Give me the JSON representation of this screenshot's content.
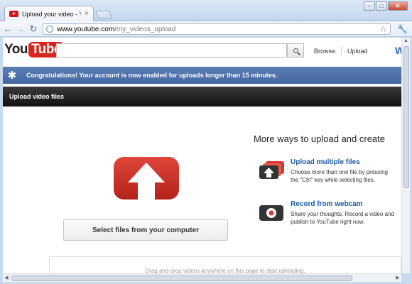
{
  "browser": {
    "tab_title": "Upload your video - YouTu",
    "tab_close": "×",
    "url_host": "www.youtube.com",
    "url_path": "/my_videos_upload",
    "window_controls": [
      "–",
      "□",
      "✕"
    ]
  },
  "header": {
    "logo_you": "You",
    "logo_tube": "Tube",
    "search_value": "",
    "links": [
      "Browse",
      "Upload"
    ],
    "cut_letter": "W"
  },
  "notice": {
    "message": "Congratulations! Your account is now enabled for uploads longer than 15 minutes."
  },
  "upload_bar": {
    "title": "Upload video files"
  },
  "main": {
    "select_button": "Select files from your computer",
    "more_title": "More ways to upload and create",
    "options": [
      {
        "title": "Upload multiple files",
        "description": "Choose more than one file by pressing the \"Ctrl\" key while selecting files.",
        "icon": "multiple-files-upload-icon"
      },
      {
        "title": "Record from webcam",
        "description": "Share your thoughts. Record a video and publish to YouTube right now.",
        "icon": "webcam-record-icon"
      }
    ],
    "dropzone_text": "Drag and drop videos anywhere on this page to start uploading."
  },
  "colors": {
    "brand_red": "#d8261c",
    "link_blue": "#1a5aa6",
    "notice_blue": "#4f73ab"
  }
}
